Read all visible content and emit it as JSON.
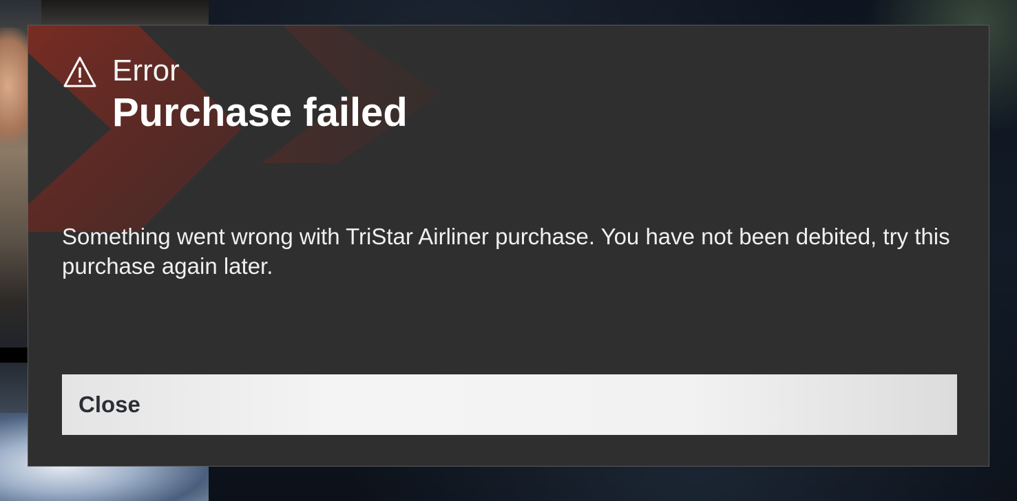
{
  "dialog": {
    "eyebrow": "Error",
    "title": "Purchase failed",
    "message": "Something went wrong with TriStar Airliner purchase. You have not been debited, try this purchase again later.",
    "close_label": "Close",
    "icon": "warning-icon"
  },
  "colors": {
    "dialog_bg": "#2f2f2f",
    "accent_red": "#7a2a22",
    "button_bg": "#f2f2f2",
    "button_text": "#2b2f35",
    "text": "#ffffff"
  }
}
